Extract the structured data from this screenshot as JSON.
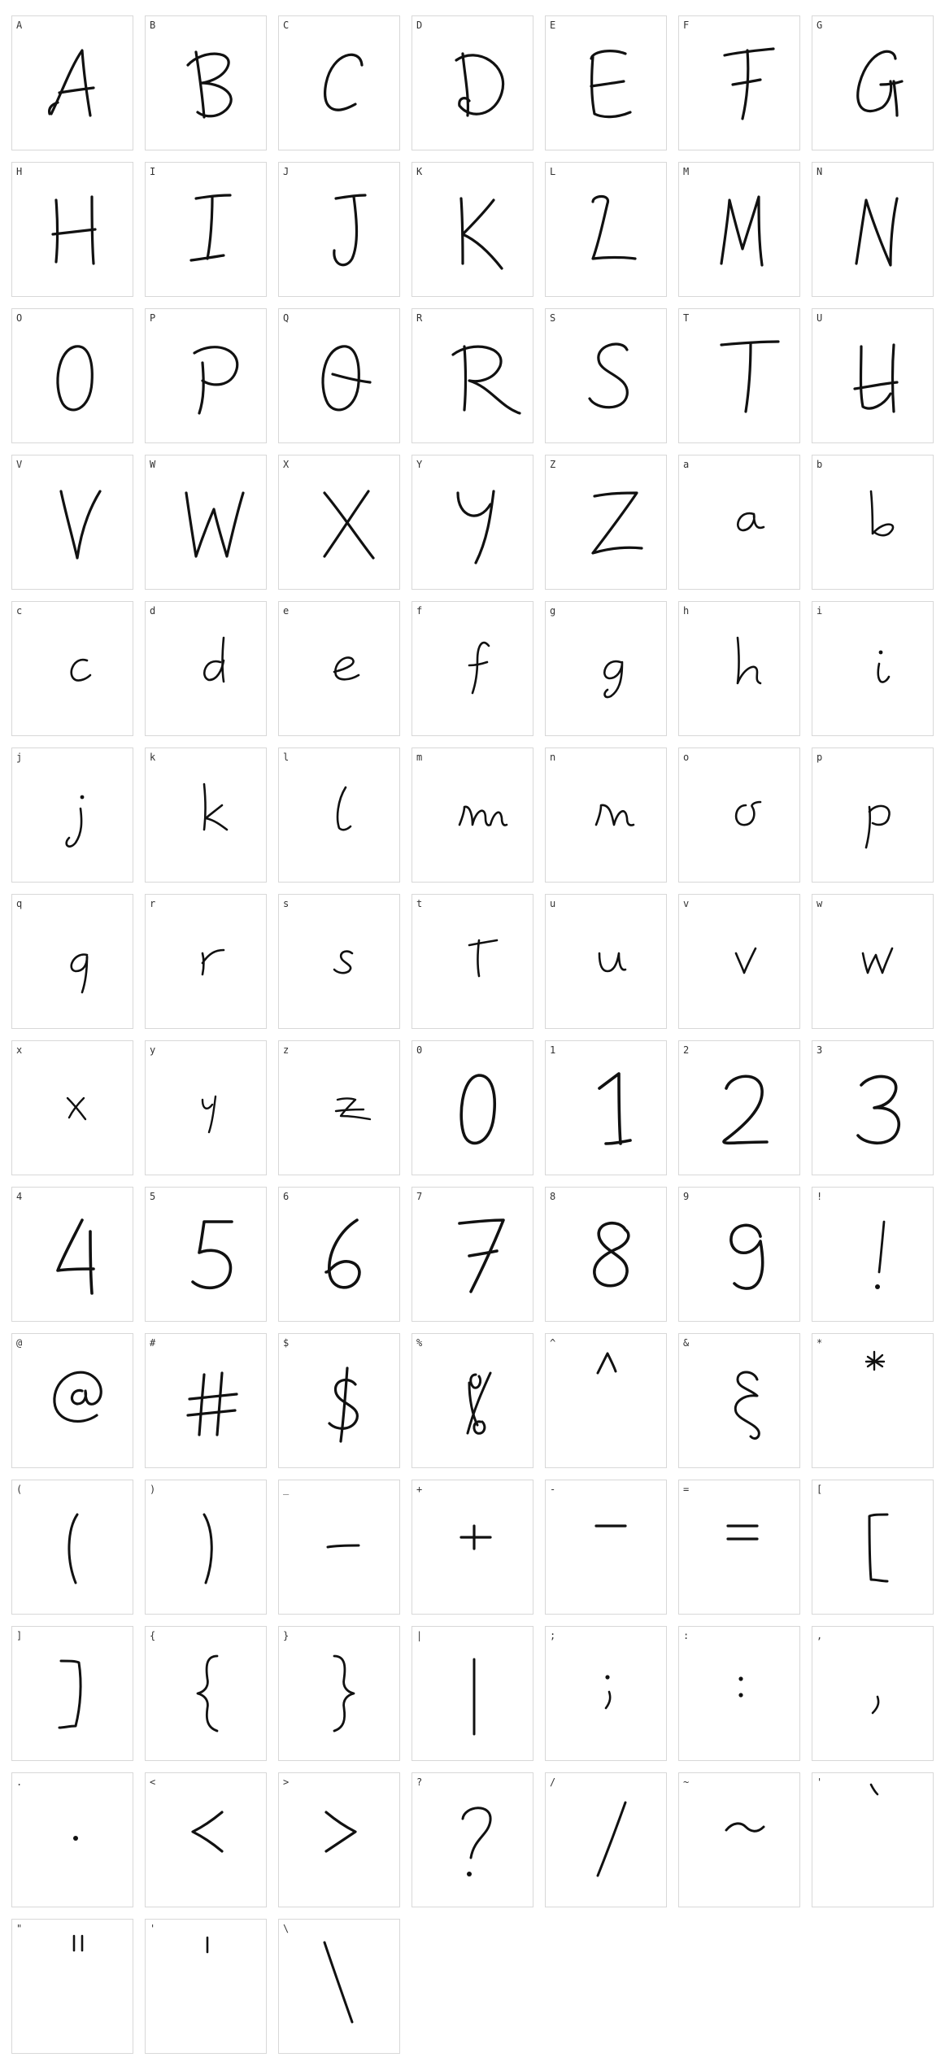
{
  "glyph_sheet": {
    "cells": [
      {
        "label": "A",
        "glyph": "A"
      },
      {
        "label": "B",
        "glyph": "B"
      },
      {
        "label": "C",
        "glyph": "C"
      },
      {
        "label": "D",
        "glyph": "D"
      },
      {
        "label": "E",
        "glyph": "E"
      },
      {
        "label": "F",
        "glyph": "F"
      },
      {
        "label": "G",
        "glyph": "G"
      },
      {
        "label": "H",
        "glyph": "H"
      },
      {
        "label": "I",
        "glyph": "I"
      },
      {
        "label": "J",
        "glyph": "J"
      },
      {
        "label": "K",
        "glyph": "K"
      },
      {
        "label": "L",
        "glyph": "L"
      },
      {
        "label": "M",
        "glyph": "M"
      },
      {
        "label": "N",
        "glyph": "N"
      },
      {
        "label": "O",
        "glyph": "O"
      },
      {
        "label": "P",
        "glyph": "P"
      },
      {
        "label": "Q",
        "glyph": "Q"
      },
      {
        "label": "R",
        "glyph": "R"
      },
      {
        "label": "S",
        "glyph": "S"
      },
      {
        "label": "T",
        "glyph": "T"
      },
      {
        "label": "U",
        "glyph": "U"
      },
      {
        "label": "V",
        "glyph": "V"
      },
      {
        "label": "W",
        "glyph": "W"
      },
      {
        "label": "X",
        "glyph": "X"
      },
      {
        "label": "Y",
        "glyph": "Y"
      },
      {
        "label": "Z",
        "glyph": "Z"
      },
      {
        "label": "a",
        "glyph": "a"
      },
      {
        "label": "b",
        "glyph": "b"
      },
      {
        "label": "c",
        "glyph": "c"
      },
      {
        "label": "d",
        "glyph": "d"
      },
      {
        "label": "e",
        "glyph": "e"
      },
      {
        "label": "f",
        "glyph": "f"
      },
      {
        "label": "g",
        "glyph": "g"
      },
      {
        "label": "h",
        "glyph": "h"
      },
      {
        "label": "i",
        "glyph": "i"
      },
      {
        "label": "j",
        "glyph": "j"
      },
      {
        "label": "k",
        "glyph": "k"
      },
      {
        "label": "l",
        "glyph": "l"
      },
      {
        "label": "m",
        "glyph": "m"
      },
      {
        "label": "n",
        "glyph": "n"
      },
      {
        "label": "o",
        "glyph": "o"
      },
      {
        "label": "p",
        "glyph": "p"
      },
      {
        "label": "q",
        "glyph": "q"
      },
      {
        "label": "r",
        "glyph": "r"
      },
      {
        "label": "s",
        "glyph": "s"
      },
      {
        "label": "t",
        "glyph": "t"
      },
      {
        "label": "u",
        "glyph": "u"
      },
      {
        "label": "v",
        "glyph": "v"
      },
      {
        "label": "w",
        "glyph": "w"
      },
      {
        "label": "x",
        "glyph": "x"
      },
      {
        "label": "y",
        "glyph": "y"
      },
      {
        "label": "z",
        "glyph": "z"
      },
      {
        "label": "0",
        "glyph": "0"
      },
      {
        "label": "1",
        "glyph": "1"
      },
      {
        "label": "2",
        "glyph": "2"
      },
      {
        "label": "3",
        "glyph": "3"
      },
      {
        "label": "4",
        "glyph": "4"
      },
      {
        "label": "5",
        "glyph": "5"
      },
      {
        "label": "6",
        "glyph": "6"
      },
      {
        "label": "7",
        "glyph": "7"
      },
      {
        "label": "8",
        "glyph": "8"
      },
      {
        "label": "9",
        "glyph": "9"
      },
      {
        "label": "!",
        "glyph": "!"
      },
      {
        "label": "@",
        "glyph": "@"
      },
      {
        "label": "#",
        "glyph": "#"
      },
      {
        "label": "$",
        "glyph": "$"
      },
      {
        "label": "%",
        "glyph": "%"
      },
      {
        "label": "^",
        "glyph": "^"
      },
      {
        "label": "&",
        "glyph": "&"
      },
      {
        "label": "*",
        "glyph": "*"
      },
      {
        "label": "(",
        "glyph": "("
      },
      {
        "label": ")",
        "glyph": ")"
      },
      {
        "label": "_",
        "glyph": "_"
      },
      {
        "label": "+",
        "glyph": "+"
      },
      {
        "label": "-",
        "glyph": "-"
      },
      {
        "label": "=",
        "glyph": "="
      },
      {
        "label": "[",
        "glyph": "["
      },
      {
        "label": "]",
        "glyph": "]"
      },
      {
        "label": "{",
        "glyph": "{"
      },
      {
        "label": "}",
        "glyph": "}"
      },
      {
        "label": "|",
        "glyph": "|"
      },
      {
        "label": ";",
        "glyph": ";"
      },
      {
        "label": ":",
        "glyph": ":"
      },
      {
        "label": ",",
        "glyph": ","
      },
      {
        "label": ".",
        "glyph": "."
      },
      {
        "label": "<",
        "glyph": "<"
      },
      {
        "label": ">",
        "glyph": ">"
      },
      {
        "label": "?",
        "glyph": "?"
      },
      {
        "label": "/",
        "glyph": "/"
      },
      {
        "label": "~",
        "glyph": "~"
      },
      {
        "label": "'",
        "glyph": "'"
      },
      {
        "label": "\"",
        "glyph": "\""
      },
      {
        "label": "'",
        "glyph": "'"
      },
      {
        "label": "\\",
        "glyph": "\\"
      }
    ]
  }
}
